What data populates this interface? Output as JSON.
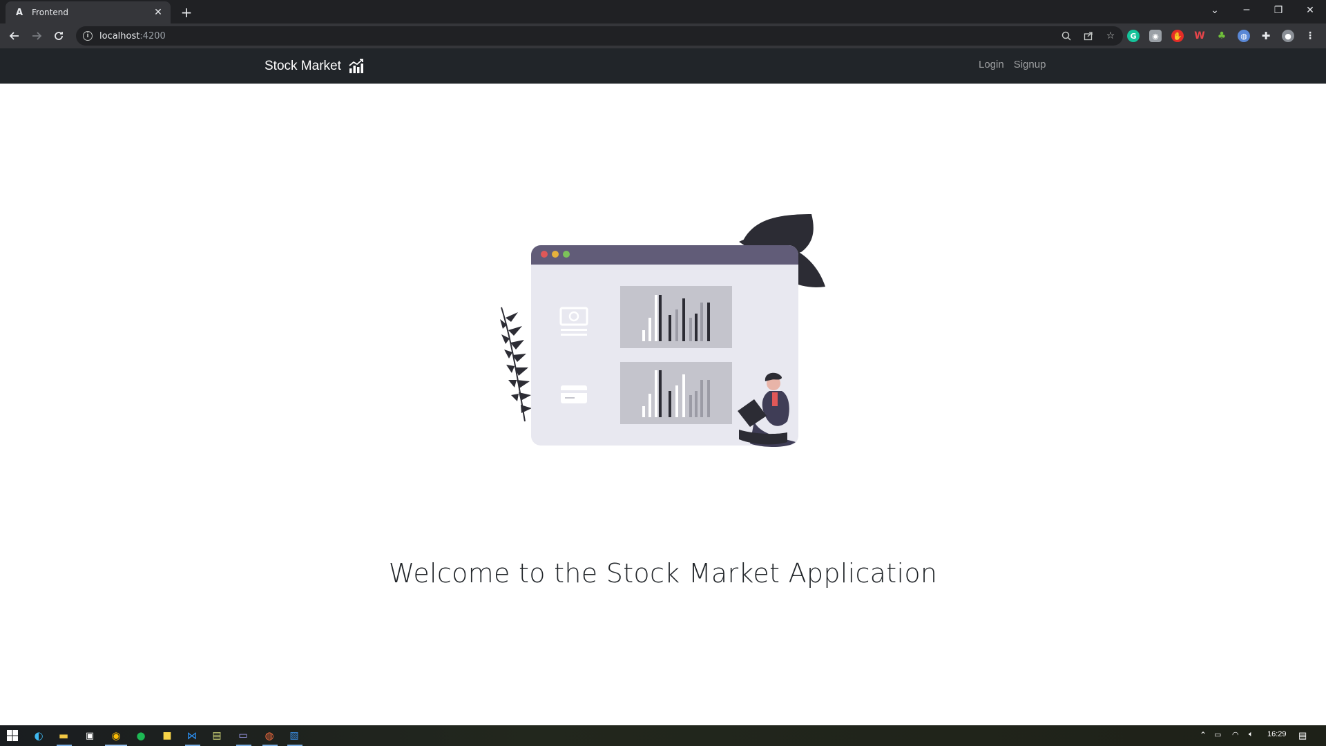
{
  "browser": {
    "tab_title": "Frontend",
    "tab_favicon_letter": "A",
    "url_host": "localhost",
    "url_port": ":4200"
  },
  "navbar": {
    "brand": "Stock Market",
    "links": [
      "Login",
      "Signup"
    ]
  },
  "hero": {
    "welcome": "Welcome to the Stock Market Application"
  },
  "taskbar": {
    "time": "16:29"
  },
  "colors": {
    "navbar_bg": "#212529",
    "window_header": "#615c78",
    "window_body": "#e8e8f0",
    "chart_panel": "#c4c4cc",
    "dot_red": "#e05858",
    "dot_yellow": "#e6b23c",
    "dot_green": "#7cc35a"
  }
}
